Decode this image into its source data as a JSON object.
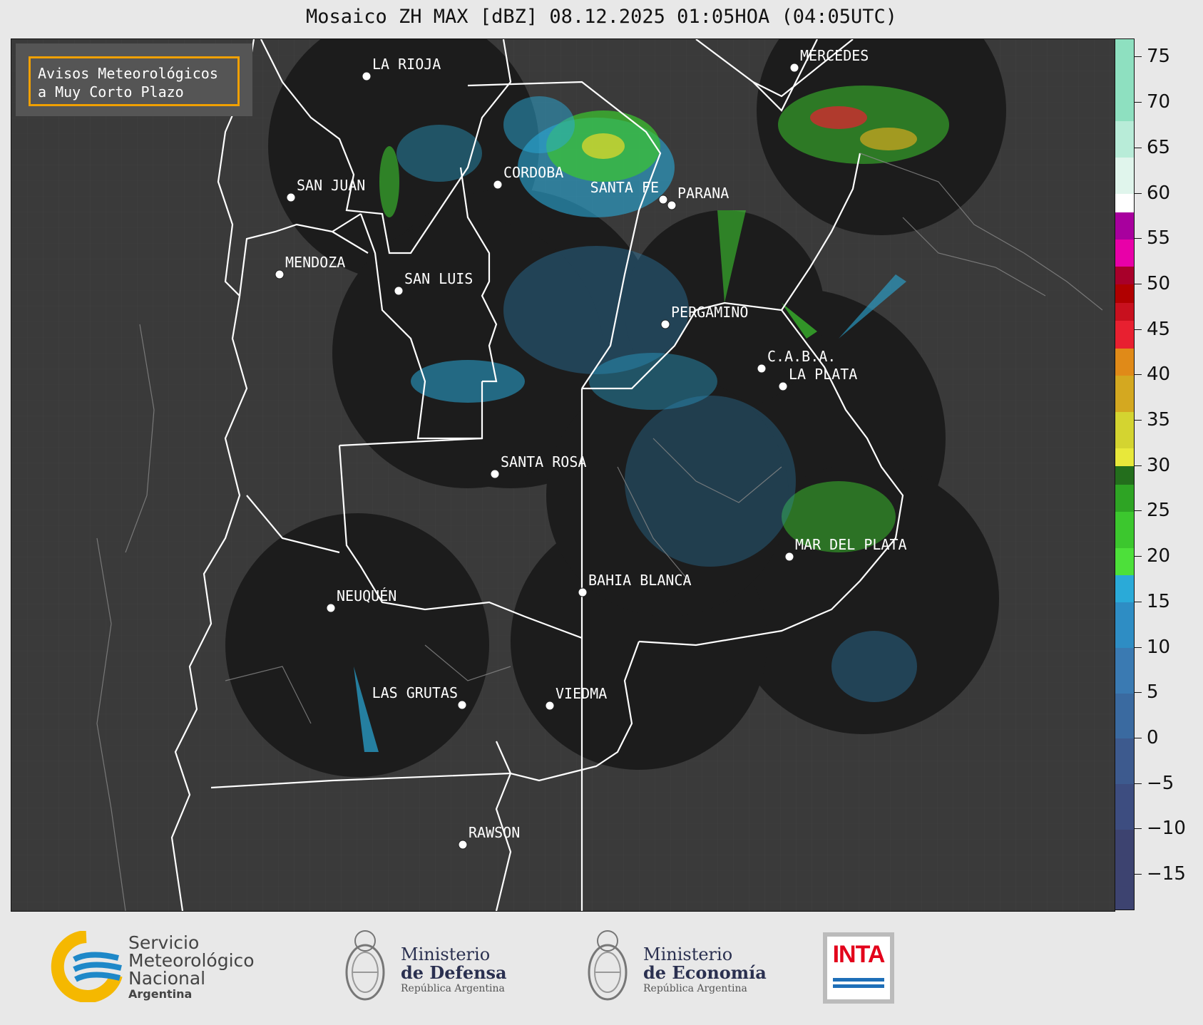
{
  "title": "Mosaico ZH MAX [dBZ] 08.12.2025 01:05HOA (04:05UTC)",
  "legend_text": [
    "Avisos Meteorológicos",
    "a Muy Corto Plazo"
  ],
  "cities": [
    {
      "name": "LA RIOJA"
    },
    {
      "name": "MERCEDES"
    },
    {
      "name": "CORDOBA"
    },
    {
      "name": "SAN JUAN"
    },
    {
      "name": "SANTA FE"
    },
    {
      "name": "PARANA"
    },
    {
      "name": "MENDOZA"
    },
    {
      "name": "SAN LUIS"
    },
    {
      "name": "PERGAMINO"
    },
    {
      "name": "C.A.B.A."
    },
    {
      "name": "LA PLATA"
    },
    {
      "name": "SANTA ROSA"
    },
    {
      "name": "MAR DEL PLATA"
    },
    {
      "name": "BAHIA BLANCA"
    },
    {
      "name": "NEUQUÉN"
    },
    {
      "name": "LAS GRUTAS"
    },
    {
      "name": "VIEDMA"
    },
    {
      "name": "RAWSON"
    }
  ],
  "colorbar": {
    "min": -19,
    "max": 77,
    "ticks": [
      75,
      70,
      65,
      60,
      55,
      50,
      45,
      40,
      35,
      30,
      25,
      20,
      15,
      10,
      5,
      0,
      -5,
      -10,
      -15
    ],
    "tick_labels": [
      "75",
      "70",
      "65",
      "60",
      "55",
      "50",
      "45",
      "40",
      "35",
      "30",
      "25",
      "20",
      "15",
      "10",
      "5",
      "0",
      "−5",
      "−10",
      "−15"
    ],
    "segments": [
      {
        "from": -19,
        "to": -10,
        "color": "#3d4370"
      },
      {
        "from": -10,
        "to": -5,
        "color": "#3d4d80"
      },
      {
        "from": -5,
        "to": 0,
        "color": "#3d5a8e"
      },
      {
        "from": 0,
        "to": 5,
        "color": "#3a6aa0"
      },
      {
        "from": 5,
        "to": 10,
        "color": "#3a7ab2"
      },
      {
        "from": 10,
        "to": 15,
        "color": "#2e8dc4"
      },
      {
        "from": 15,
        "to": 18,
        "color": "#2aaad8"
      },
      {
        "from": 18,
        "to": 21,
        "color": "#4de03a"
      },
      {
        "from": 21,
        "to": 25,
        "color": "#3cc72e"
      },
      {
        "from": 25,
        "to": 28,
        "color": "#2ea424"
      },
      {
        "from": 28,
        "to": 30,
        "color": "#236e1c"
      },
      {
        "from": 30,
        "to": 32,
        "color": "#e8e83a"
      },
      {
        "from": 32,
        "to": 36,
        "color": "#d4d430"
      },
      {
        "from": 36,
        "to": 40,
        "color": "#d4a820"
      },
      {
        "from": 40,
        "to": 43,
        "color": "#e08a18"
      },
      {
        "from": 43,
        "to": 46,
        "color": "#e82030"
      },
      {
        "from": 46,
        "to": 48,
        "color": "#c8101e"
      },
      {
        "from": 48,
        "to": 50,
        "color": "#b00000"
      },
      {
        "from": 50,
        "to": 52,
        "color": "#a8002a"
      },
      {
        "from": 52,
        "to": 55,
        "color": "#e800a8"
      },
      {
        "from": 55,
        "to": 58,
        "color": "#a8009e"
      },
      {
        "from": 58,
        "to": 60,
        "color": "#ffffff"
      },
      {
        "from": 60,
        "to": 64,
        "color": "#e0f5ec"
      },
      {
        "from": 64,
        "to": 68,
        "color": "#b8ecd8"
      },
      {
        "from": 68,
        "to": 77,
        "color": "#8ee0c0"
      }
    ]
  },
  "footer": {
    "smn": [
      "Servicio",
      "Meteorológico",
      "Nacional",
      "Argentina"
    ],
    "defensa": [
      "Ministerio",
      "de Defensa",
      "República Argentina"
    ],
    "economia": [
      "Ministerio",
      "de Economía",
      "República Argentina"
    ],
    "inta": "INTA"
  },
  "colors": {
    "map_bg": "#3a3a3a",
    "radar_disc": "#1c1c1c",
    "legend_border": "#f0a000",
    "smn_yellow": "#f5b800",
    "smn_blue": "#1e88c8",
    "inta_red": "#e3001b"
  }
}
